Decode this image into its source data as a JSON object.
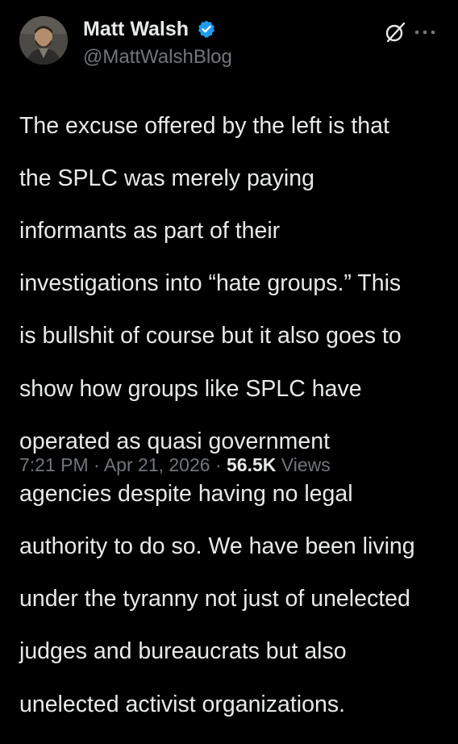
{
  "author": {
    "name": "Matt Walsh",
    "handle": "@MattWalshBlog",
    "verified": true
  },
  "icons": {
    "verified": "verified-badge-icon",
    "grok": "grok-slash-icon",
    "more": "more-options-icon"
  },
  "colors": {
    "background": "#000000",
    "text": "#e7e9ea",
    "secondary": "#71767b",
    "verified": "#1d9bf0"
  },
  "tweet": {
    "text_lines": [
      "The excuse offered by the left is that",
      "the SPLC was merely paying",
      "informants as part of their",
      "investigations into “hate groups.” This",
      "is bullshit of course but it also goes to",
      "show how groups like SPLC have",
      "operated as quasi government",
      "agencies despite having no legal",
      "authority to do so. We have been living",
      "under the tyranny not just of unelected",
      "judges and bureaucrats but also",
      "unelected activist organizations."
    ],
    "time": "7:21 PM",
    "date": "Apr 21, 2026",
    "separator": "·",
    "views_count": "56.5K",
    "views_label": "Views"
  }
}
